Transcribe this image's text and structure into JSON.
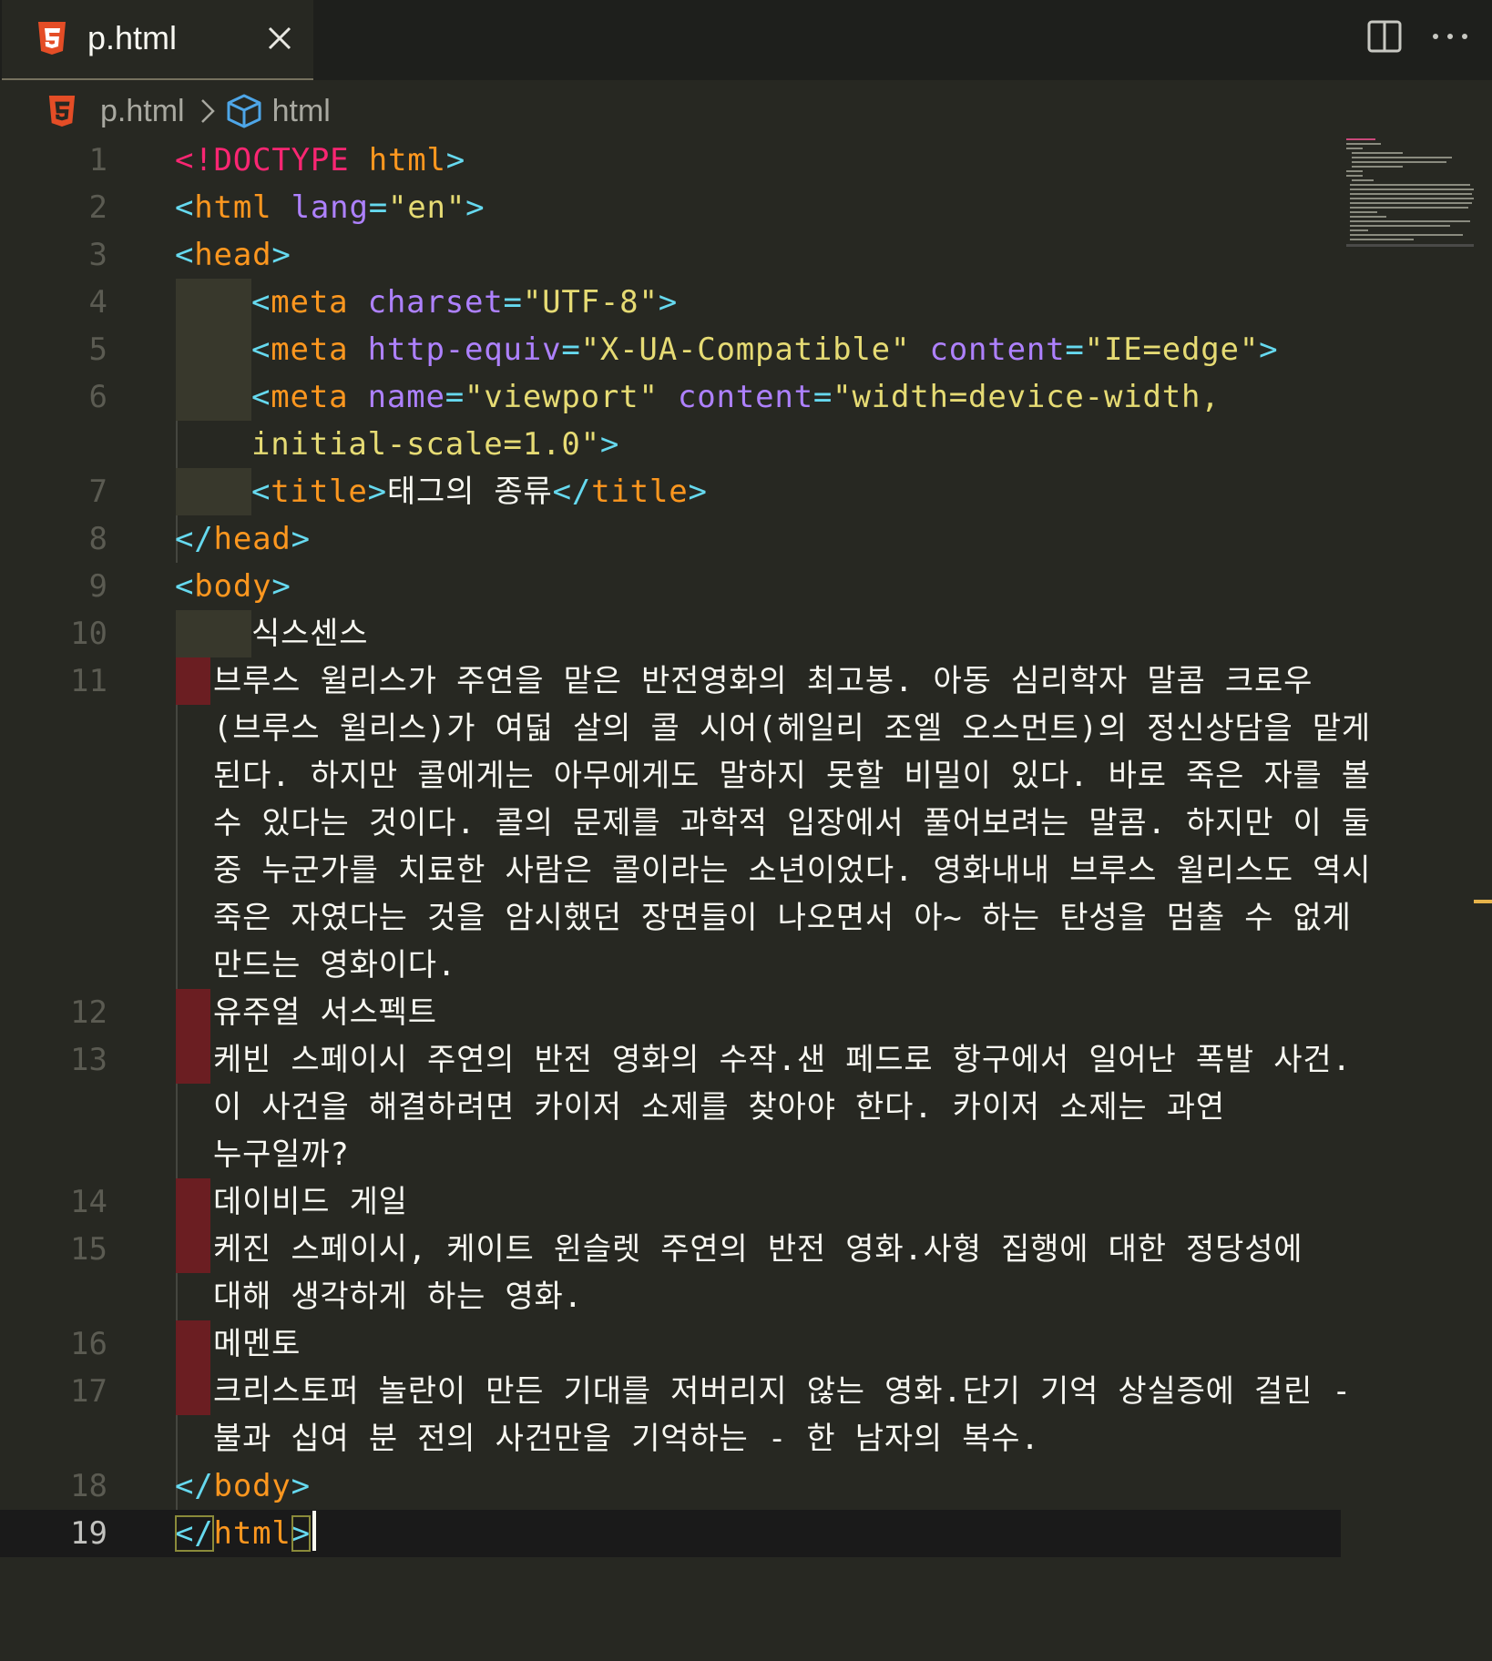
{
  "tab": {
    "filename": "p.html",
    "file_icon": "html5-icon",
    "close_icon": "close-icon"
  },
  "toolbar": {
    "split_icon": "split-editor-icon",
    "more_icon": "more-actions-icon"
  },
  "breadcrumb": {
    "file": "p.html",
    "symbol": "html",
    "symbol_icon": "cube-icon"
  },
  "editor": {
    "active_line": "19",
    "lines": [
      {
        "number": "1",
        "t1": "<!DOCTYPE",
        "t2": " html",
        "t3": ">"
      },
      {
        "number": "2",
        "t1": "<",
        "t2": "html",
        "t3": " lang",
        "t4": "=",
        "t5": "\"en\"",
        "t6": ">"
      },
      {
        "number": "3",
        "t1": "<",
        "t2": "head",
        "t3": ">"
      },
      {
        "number": "4",
        "t1": "<",
        "t2": "meta",
        "t3": " charset",
        "t4": "=",
        "t5": "\"UTF-8\"",
        "t6": ">"
      },
      {
        "number": "5",
        "t1": "<",
        "t2": "meta",
        "t3": " http-equiv",
        "t4": "=",
        "t5": "\"X-UA-Compatible\"",
        "t6": " content",
        "t7": "=",
        "t8": "\"IE=edge\"",
        "t9": ">"
      },
      {
        "number": "6",
        "t1": "<",
        "t2": "meta",
        "t3": " name",
        "t4": "=",
        "t5": "\"viewport\"",
        "t6": " content",
        "t7": "=",
        "t8": "\"width=device-width,",
        "wrap": "initial-scale=1.0\"",
        "wrap_end": ">"
      },
      {
        "number": "7",
        "t1": "<",
        "t2": "title",
        "t3": ">",
        "text": "태그의 종류",
        "t4": "</",
        "t5": "title",
        "t6": ">"
      },
      {
        "number": "8",
        "t1": "</",
        "t2": "head",
        "t3": ">"
      },
      {
        "number": "9",
        "t1": "<",
        "t2": "body",
        "t3": ">"
      },
      {
        "number": "10",
        "text": "식스센스"
      },
      {
        "number": "11",
        "wrapped": [
          "브루스 윌리스가 주연을 맡은 반전영화의 최고봉. 아동 심리학자 말콤 크로우",
          "(브루스 윌리스)가 여덟 살의 콜 시어(헤일리 조엘 오스먼트)의 정신상담을 맡게",
          "된다. 하지만 콜에게는 아무에게도 말하지 못할 비밀이 있다. 바로 죽은 자를 볼",
          "수 있다는 것이다. 콜의 문제를 과학적 입장에서 풀어보려는 말콤. 하지만 이 둘",
          "중 누군가를 치료한 사람은 콜이라는 소년이었다. 영화내내 브루스 윌리스도 역시",
          "죽은 자였다는 것을 암시했던 장면들이 나오면서 아~ 하는 탄성을 멈출 수 없게",
          "만드는 영화이다."
        ]
      },
      {
        "number": "12",
        "text": "유주얼 서스펙트"
      },
      {
        "number": "13",
        "wrapped": [
          "케빈 스페이시 주연의 반전 영화의 수작.샌 페드로 항구에서 일어난 폭발 사건.",
          "이 사건을 해결하려면 카이저 소제를 찾아야 한다. 카이저 소제는 과연",
          "누구일까?"
        ]
      },
      {
        "number": "14",
        "text": "데이비드 게일"
      },
      {
        "number": "15",
        "wrapped": [
          "케진 스페이시, 케이트 윈슬렛 주연의 반전 영화.사형 집행에 대한 정당성에",
          "대해 생각하게 하는 영화."
        ]
      },
      {
        "number": "16",
        "text": "메멘토"
      },
      {
        "number": "17",
        "wrapped": [
          "크리스토퍼 놀란이 만든 기대를 저버리지 않는 영화.단기 기억 상실증에 걸린 -",
          "불과 십여 분 전의 사건만을 기억하는 - 한 남자의 복수."
        ]
      },
      {
        "number": "18",
        "t1": "</",
        "t2": "body",
        "t3": ">"
      },
      {
        "number": "19",
        "t1": "</",
        "t2": "html",
        "t3": ">"
      }
    ]
  },
  "colors": {
    "background": "#272822",
    "tag_bracket": "#66d9ef",
    "tag_name": "#fd971f",
    "attribute": "#ae81ff",
    "string": "#e6db74",
    "doctype": "#f92672",
    "text": "#f8f8f2",
    "line_number": "#5b5b52",
    "error_indent": "#6b1e22",
    "html5_icon": "#e44d26"
  }
}
